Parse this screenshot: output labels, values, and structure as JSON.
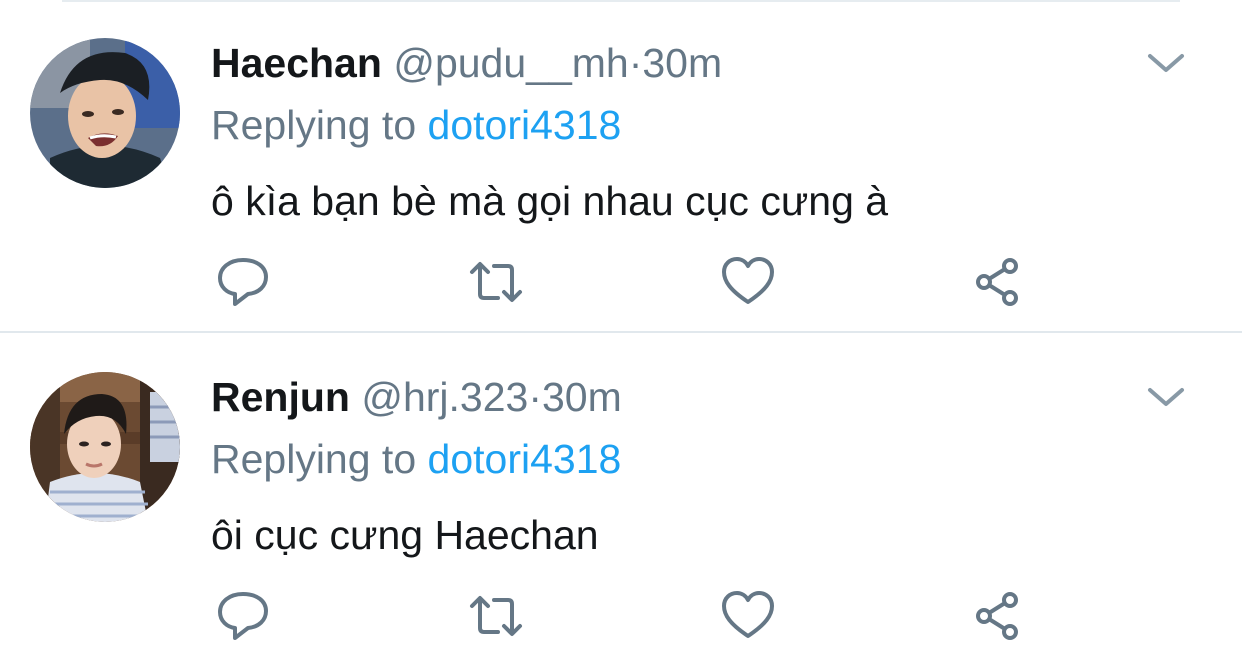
{
  "tweets": [
    {
      "display_name": "Haechan",
      "handle": "@pudu__mh",
      "separator": "·",
      "time": "30m",
      "replying_prefix": "Replying to",
      "replying_to": "dotori4318",
      "text": "ô kìa bạn bè mà gọi nhau cục cưng à",
      "avatar": "avatar-photo",
      "icons": [
        "chevron-down-icon",
        "reply-icon",
        "retweet-icon",
        "like-icon",
        "share-icon"
      ]
    },
    {
      "display_name": "Renjun",
      "handle": "@hrj.323",
      "separator": "·",
      "time": "30m",
      "replying_prefix": "Replying to",
      "replying_to": "dotori4318",
      "text": "ôi cục cưng Haechan",
      "avatar": "avatar-photo",
      "icons": [
        "chevron-down-icon",
        "reply-icon",
        "retweet-icon",
        "like-icon",
        "share-icon"
      ]
    }
  ],
  "colors": {
    "text_primary": "#14171a",
    "text_secondary": "#657786",
    "link": "#1da1f2",
    "icon": "#657786",
    "divider": "#e1e8ed"
  }
}
